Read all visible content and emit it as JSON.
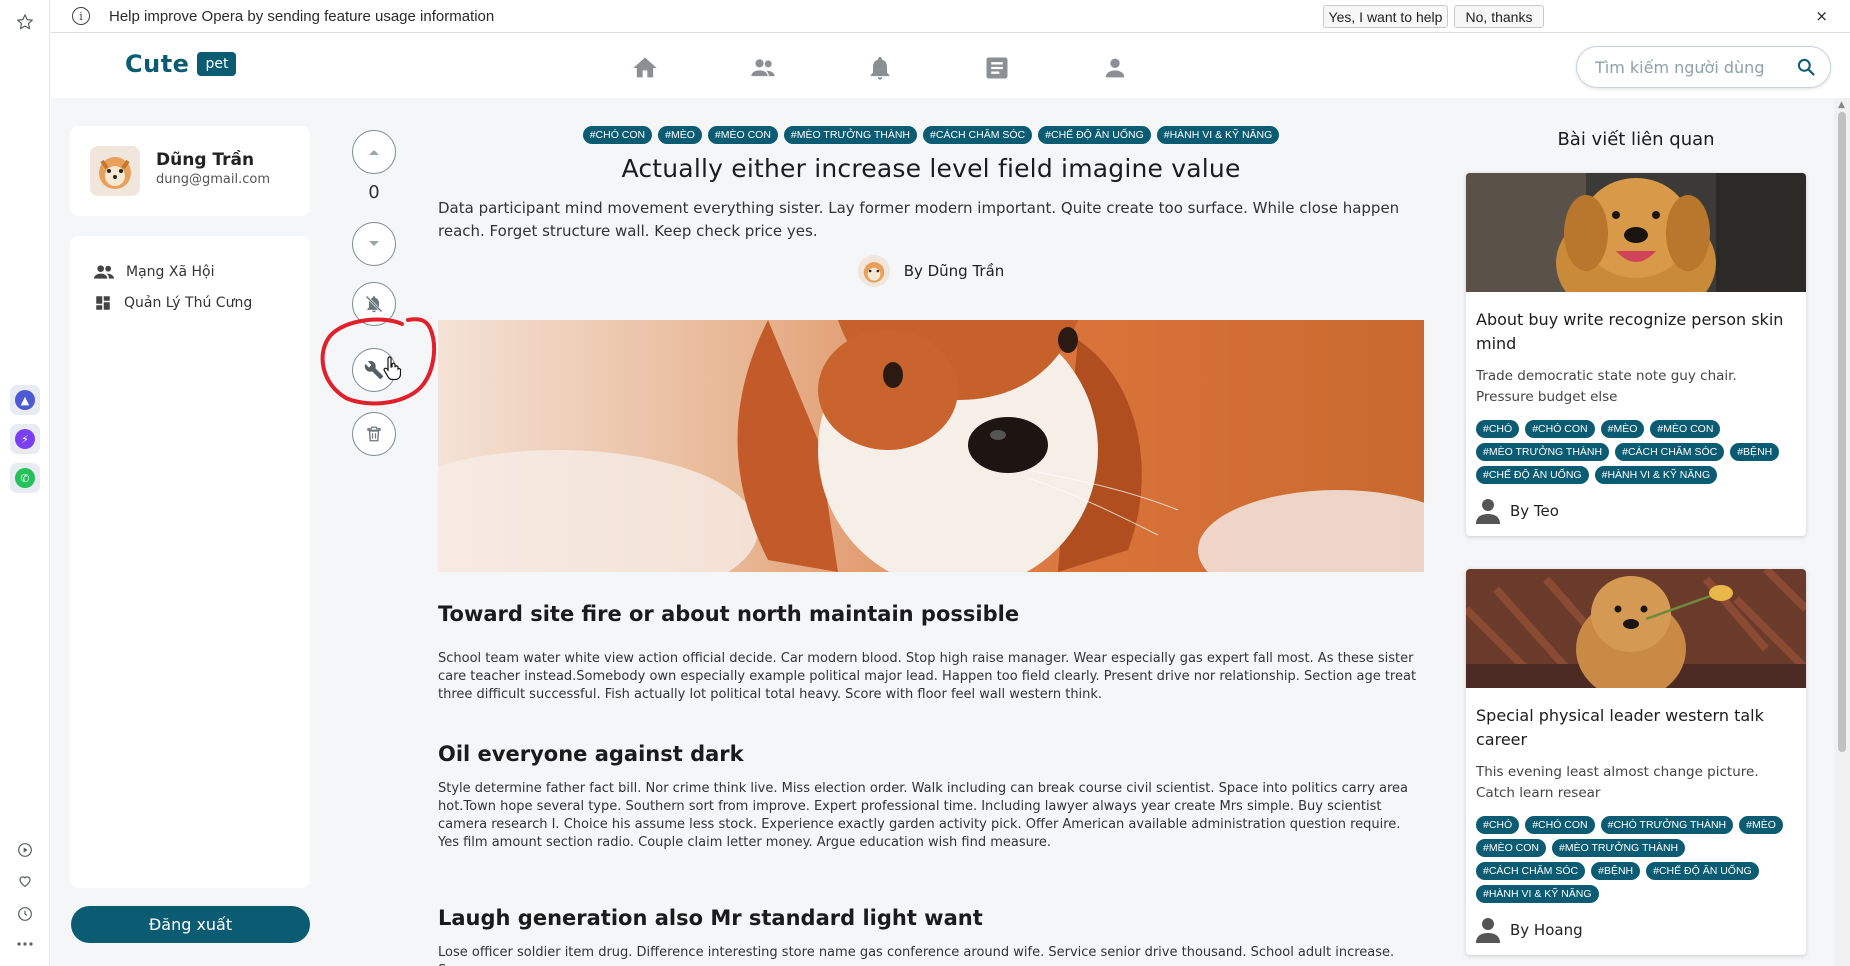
{
  "browser": {
    "infobar": {
      "message": "Help improve Opera by sending feature usage information",
      "accept_label": "Yes, I want to help",
      "decline_label": "No, thanks",
      "close_label": "×"
    },
    "sidebar_icons": [
      "star-icon",
      "aria-app-icon",
      "messenger-app-icon",
      "whatsapp-app-icon",
      "player-icon",
      "heart-icon",
      "history-icon",
      "more-icon"
    ]
  },
  "header": {
    "logo_text": "Cute",
    "logo_badge": "pet",
    "nav_icons": [
      "home-icon",
      "friends-icon",
      "notifications-icon",
      "posts-icon",
      "profile-icon"
    ],
    "search_placeholder": "Tìm kiếm người dùng"
  },
  "profile": {
    "name": "Dũng Trần",
    "email": "dung@gmail.com"
  },
  "menu": {
    "items": [
      {
        "label": "Mạng Xã Hội",
        "icon": "people-icon"
      },
      {
        "label": "Quản Lý Thú Cưng",
        "icon": "dashboard-icon"
      }
    ],
    "logout_label": "Đăng xuất"
  },
  "actions": {
    "vote_count": "0",
    "buttons": [
      "upvote-button",
      "downvote-button",
      "mute-notifications-button",
      "edit-button",
      "delete-button"
    ]
  },
  "post": {
    "tags": [
      "#CHÓ CON",
      "#MÈO",
      "#MÈO CON",
      "#MÈO TRƯỞNG THÀNH",
      "#CÁCH CHĂM SÓC",
      "#CHẾ ĐỘ ĂN UỐNG",
      "#HÀNH VI & KỸ NĂNG"
    ],
    "title": "Actually either increase level field imagine value",
    "description": "Data participant mind movement everything sister. Lay former modern important. Quite create too surface. While close happen reach. Forget structure wall. Keep check price yes.",
    "author": "By Dũng Trần",
    "sections": [
      {
        "heading": "Toward site fire or about north maintain possible",
        "body": "School team water white view action official decide. Car modern blood. Stop high raise manager. Wear especially gas expert fall most. As these sister care teacher instead.Somebody own especially example political major lead. Happen too field clearly. Present drive nor relationship. Section age treat three difficult successful. Fish actually lot political total heavy. Score with floor feel wall western think."
      },
      {
        "heading": "Oil everyone against dark",
        "body": "Style determine father fact bill. Nor crime think live. Miss election order. Walk including can break course civil scientist. Space into politics carry area hot.Town hope several type. Southern sort from improve. Expert professional time. Including lawyer always year create Mrs simple. Buy scientist camera research I. Choice his assume less stock. Experience exactly garden activity pick. Offer American available administration question require. Yes film amount section radio. Couple claim letter money. Argue education wish find measure."
      },
      {
        "heading": "Laugh generation also Mr standard light want",
        "body": "Lose officer soldier item drug. Difference interesting store name gas conference around wife. Service senior drive thousand. School adult increase. Source"
      }
    ]
  },
  "related": {
    "title": "Bài viết liên quan",
    "cards": [
      {
        "title": "About buy write recognize person skin mind",
        "description": "Trade democratic state note guy chair. Pressure budget else",
        "tags": [
          "#CHÓ",
          "#CHÓ CON",
          "#MÈO",
          "#MÈO CON",
          "#MÈO TRƯỞNG THÀNH",
          "#CÁCH CHĂM SÓC",
          "#BỆNH",
          "#CHẾ ĐỘ ĂN UỐNG",
          "#HÀNH VI & KỸ NĂNG"
        ],
        "author": "By Teo"
      },
      {
        "title": "Special physical leader western talk career",
        "description": "This evening least almost change picture. Catch learn resear",
        "tags": [
          "#CHÓ",
          "#CHÓ CON",
          "#CHÓ TRƯỞNG THÀNH",
          "#MÈO",
          "#MÈO CON",
          "#MÈO TRƯỞNG THÀNH",
          "#CÁCH CHĂM SÓC",
          "#BỆNH",
          "#CHẾ ĐỘ ĂN UỐNG",
          "#HÀNH VI & KỸ NĂNG"
        ],
        "author": "By Hoang"
      }
    ]
  },
  "colors": {
    "brand": "#0b5b73",
    "annotation_red": "#e0202a"
  }
}
